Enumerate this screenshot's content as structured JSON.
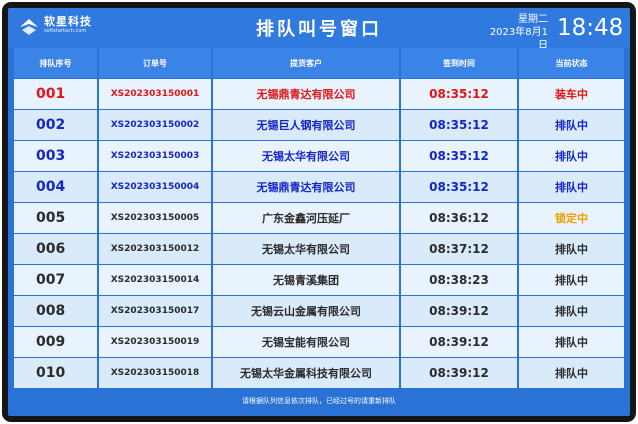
{
  "header": {
    "logo_name": "软星科技",
    "logo_url": "softstartech.com",
    "title": "排队叫号窗口",
    "weekday": "星期二",
    "date": "2023年8月1日",
    "clock": "18:48"
  },
  "table": {
    "columns": [
      "排队序号",
      "订单号",
      "提货客户",
      "签到时间",
      "当前状态"
    ],
    "rows": [
      {
        "num": "001",
        "order": "XS202303150001",
        "customer": "无锡鼎青达有限公司",
        "time": "08:35:12",
        "status": "装车中",
        "color": "red"
      },
      {
        "num": "002",
        "order": "XS202303150002",
        "customer": "无锡巨人钢有限公司",
        "time": "08:35:12",
        "status": "排队中",
        "color": "blue"
      },
      {
        "num": "003",
        "order": "XS202303150003",
        "customer": "无锡太华有限公司",
        "time": "08:35:12",
        "status": "排队中",
        "color": "blue"
      },
      {
        "num": "004",
        "order": "XS202303150004",
        "customer": "无锡鼎青达有限公司",
        "time": "08:35:12",
        "status": "排队中",
        "color": "blue"
      },
      {
        "num": "005",
        "order": "XS202303150005",
        "customer": "广东金鑫河压延厂",
        "time": "08:36:12",
        "status": "锁定中",
        "color": "dark",
        "status_color": "orange"
      },
      {
        "num": "006",
        "order": "XS202303150012",
        "customer": "无锡太华有限公司",
        "time": "08:37:12",
        "status": "排队中",
        "color": "dark"
      },
      {
        "num": "007",
        "order": "XS202303150014",
        "customer": "无锡青溪集团",
        "time": "08:38:23",
        "status": "排队中",
        "color": "dark"
      },
      {
        "num": "008",
        "order": "XS202303150017",
        "customer": "无锡云山金属有限公司",
        "time": "08:39:12",
        "status": "排队中",
        "color": "dark"
      },
      {
        "num": "009",
        "order": "XS202303150019",
        "customer": "无锡宝能有限公司",
        "time": "08:39:12",
        "status": "排队中",
        "color": "dark"
      },
      {
        "num": "010",
        "order": "XS202303150018",
        "customer": "无锡太华金属科技有限公司",
        "time": "08:39:12",
        "status": "排队中",
        "color": "dark"
      }
    ]
  },
  "footer": {
    "notice": "请根据队列信息依次排队，已经过号的请重新排队"
  },
  "colors": {
    "screen_bg": "#2a72d6",
    "header_bg": "#3a84e8",
    "row_light": "#e9f3fd",
    "row_alt": "#d9ebfb",
    "red": "#e01515",
    "blue": "#1426c8",
    "orange": "#f0a000"
  }
}
